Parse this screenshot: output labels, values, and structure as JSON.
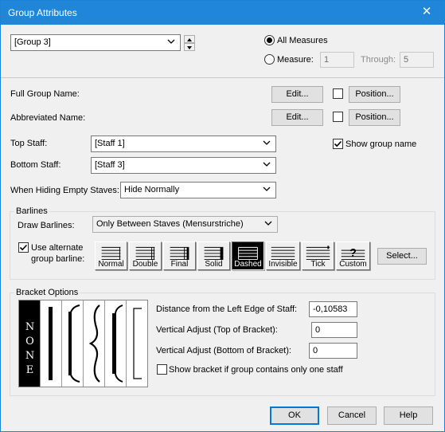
{
  "window": {
    "title": "Group Attributes",
    "close_glyph": "✕"
  },
  "group_select": {
    "value": "[Group 3]"
  },
  "measures": {
    "all_label": "All Measures",
    "measure_label": "Measure:",
    "measure_value": "1",
    "through_label": "Through:",
    "through_value": "5",
    "selected": "all"
  },
  "names": {
    "full_label": "Full Group Name:",
    "abbrev_label": "Abbreviated Name:",
    "edit_label": "Edit...",
    "position_label": "Position..."
  },
  "staves": {
    "top_label": "Top Staff:",
    "top_value": "[Staff 1]",
    "bottom_label": "Bottom Staff:",
    "bottom_value": "[Staff 3]",
    "show_group_name_label": "Show group name",
    "show_group_name_checked": true,
    "hiding_label": "When Hiding Empty Staves:",
    "hiding_value": "Hide Normally"
  },
  "barlines": {
    "group_title": "Barlines",
    "draw_label": "Draw Barlines:",
    "draw_value": "Only Between Staves (Mensurstriche)",
    "alternate_label_1": "Use alternate",
    "alternate_label_2": "group barline:",
    "alternate_checked": true,
    "styles": [
      "Normal",
      "Double",
      "Final",
      "Solid",
      "Dashed",
      "Invisible",
      "Tick",
      "Custom"
    ],
    "selected_style": "Dashed",
    "select_label": "Select..."
  },
  "bracket": {
    "group_title": "Bracket Options",
    "none_text": "NONE",
    "distance_label": "Distance from the Left Edge of Staff:",
    "distance_value": "-0,10583",
    "vtop_label": "Vertical Adjust (Top of Bracket):",
    "vtop_value": "0",
    "vbottom_label": "Vertical Adjust (Bottom of Bracket):",
    "vbottom_value": "0",
    "show_single_label": "Show bracket if group contains only one staff",
    "show_single_checked": false
  },
  "footer": {
    "ok_label": "OK",
    "cancel_label": "Cancel",
    "help_label": "Help"
  }
}
